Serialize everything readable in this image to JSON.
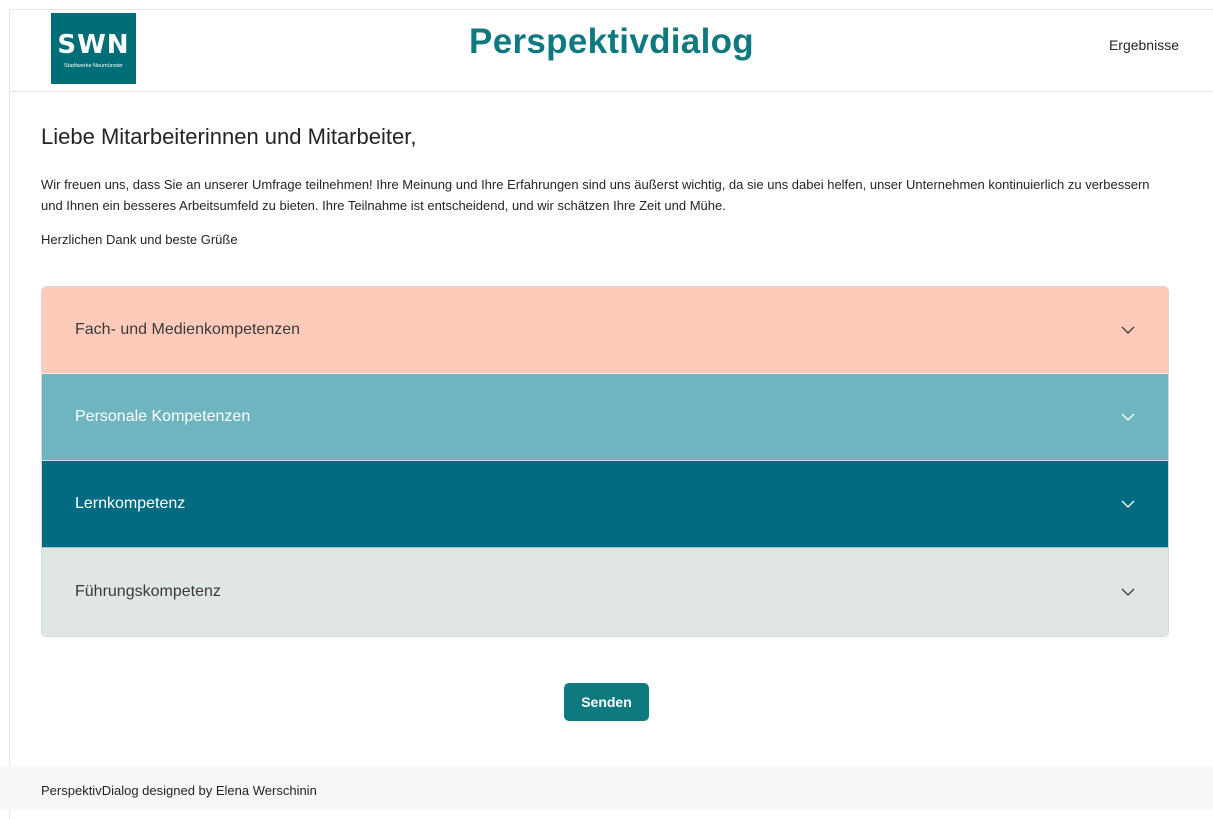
{
  "header": {
    "logo_mark": "SWN",
    "logo_subtitle": "Stadtwerke Neumünster",
    "title": "Perspektivdialog",
    "nav_results": "Ergebnisse"
  },
  "main": {
    "greeting": "Liebe Mitarbeiterinnen und Mitarbeiter,",
    "intro": "Wir freuen uns, dass Sie an unserer Umfrage teilnehmen! Ihre Meinung und Ihre Erfahrungen sind uns äußerst wichtig, da sie uns dabei helfen, unser Unternehmen kontinuierlich zu verbessern und Ihnen ein besseres Arbeitsumfeld zu bieten. Ihre Teilnahme ist entscheidend, und wir schätzen Ihre Zeit und Mühe.",
    "sign_off": "Herzlichen Dank und beste Grüße"
  },
  "accordion": {
    "items": [
      {
        "label": "Fach- und Medienkompetenzen",
        "bg": "#fecbbb",
        "color": "#3a3a3a",
        "icon": "chevron-down-icon"
      },
      {
        "label": "Personale Kompetenzen",
        "bg": "#6fb5bf",
        "color": "#ffffff",
        "icon": "chevron-down-icon"
      },
      {
        "label": "Lernkompetenz",
        "bg": "#006b81",
        "color": "#ffffff",
        "icon": "chevron-down-icon"
      },
      {
        "label": "Führungskompetenz",
        "bg": "#e0e6e2",
        "color": "#3a3a3a",
        "icon": "chevron-down-icon"
      }
    ]
  },
  "actions": {
    "send_label": "Senden"
  },
  "footer": {
    "text": "PerspektivDialog designed by Elena Werschinin"
  },
  "colors": {
    "brand": "#0e7a7f",
    "logo_bg": "#006e77"
  }
}
